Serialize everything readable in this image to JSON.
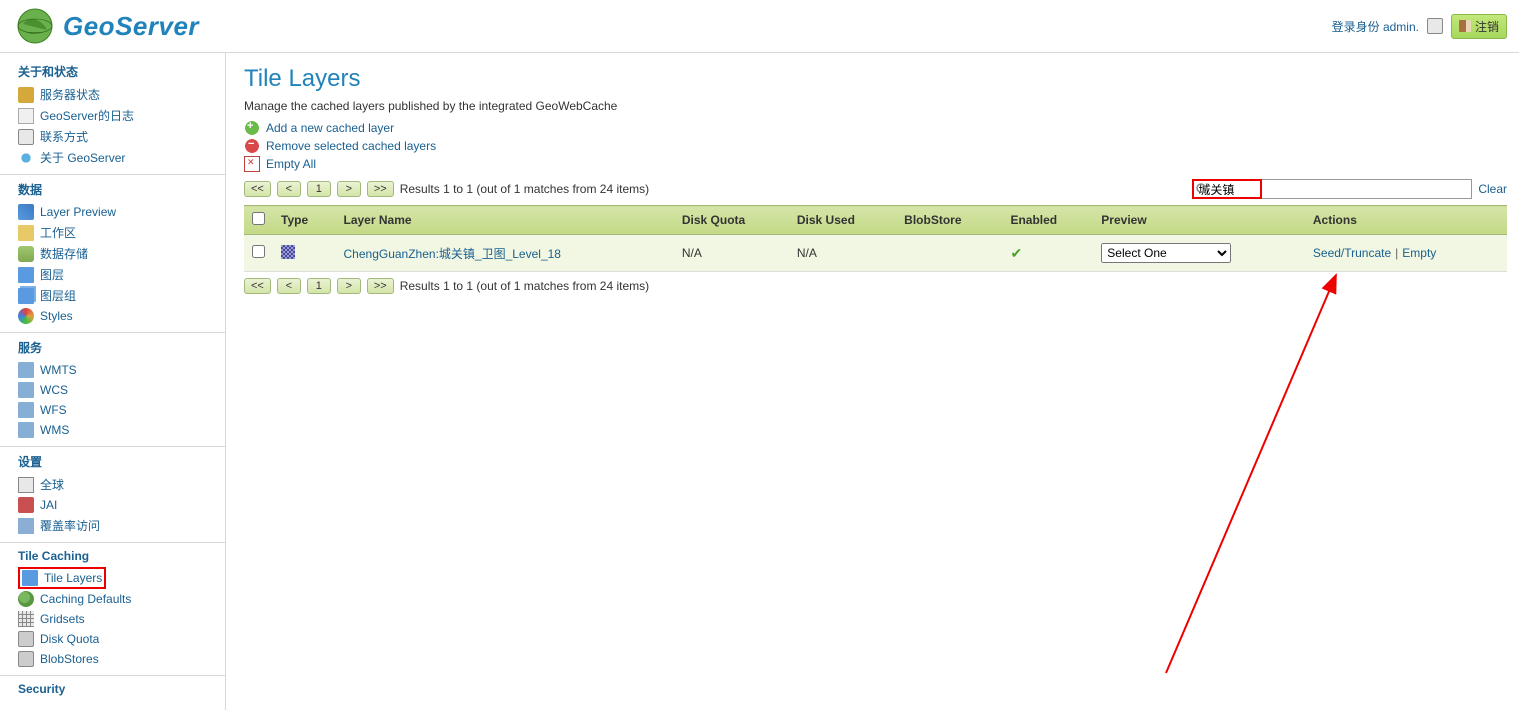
{
  "brand": "GeoServer",
  "header": {
    "login_label": "登录身份",
    "user": "admin.",
    "logout": "注销"
  },
  "sidebar": {
    "about": {
      "heading": "关于和状态",
      "items": [
        "服务器状态",
        "GeoServer的日志",
        "联系方式",
        "关于 GeoServer"
      ]
    },
    "data": {
      "heading": "数据",
      "items": [
        "Layer Preview",
        "工作区",
        "数据存储",
        "图层",
        "图层组",
        "Styles"
      ]
    },
    "services": {
      "heading": "服务",
      "items": [
        "WMTS",
        "WCS",
        "WFS",
        "WMS"
      ]
    },
    "settings": {
      "heading": "设置",
      "items": [
        "全球",
        "JAI",
        "覆盖率访问"
      ]
    },
    "tilecaching": {
      "heading": "Tile Caching",
      "items": [
        "Tile Layers",
        "Caching Defaults",
        "Gridsets",
        "Disk Quota",
        "BlobStores"
      ]
    },
    "security": {
      "heading": "Security"
    }
  },
  "page": {
    "title": "Tile Layers",
    "subtitle": "Manage the cached layers published by the integrated GeoWebCache",
    "action_add": "Add a new cached layer",
    "action_remove": "Remove selected cached layers",
    "action_empty": "Empty All"
  },
  "pager": {
    "first": "<<",
    "prev": "<",
    "page": "1",
    "next": ">",
    "last": ">>",
    "results": "Results 1 to 1 (out of 1 matches from 24 items)",
    "search_value": "城关镇",
    "clear": "Clear"
  },
  "table": {
    "headers": [
      "",
      "Type",
      "Layer Name",
      "Disk Quota",
      "Disk Used",
      "BlobStore",
      "Enabled",
      "Preview",
      "Actions"
    ],
    "row": {
      "layer_name": "ChengGuanZhen:城关镇_卫图_Level_18",
      "disk_quota": "N/A",
      "disk_used": "N/A",
      "blobstore": "",
      "preview_select": "Select One",
      "action_seed": "Seed/Truncate",
      "action_empty": "Empty"
    }
  }
}
